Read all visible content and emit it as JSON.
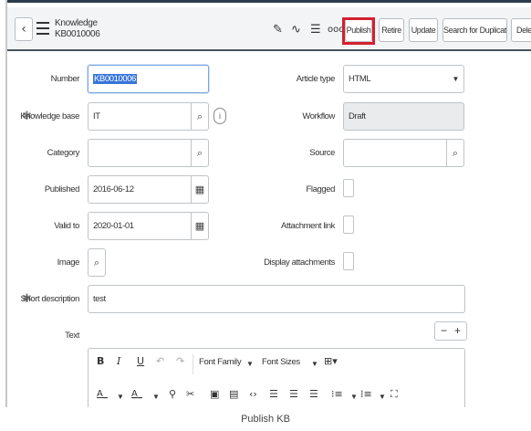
{
  "header": {
    "title": "Knowledge",
    "subtitle": "KB0010006",
    "buttons": {
      "publish": "Publish",
      "retire": "Retire",
      "update": "Update",
      "search_dup": "Search for Duplicates",
      "delete": "Delete"
    }
  },
  "form": {
    "number": {
      "label": "Number",
      "value": "KB0010006"
    },
    "knowledge_base": {
      "label": "Knowledge base",
      "value": "IT"
    },
    "category": {
      "label": "Category",
      "value": ""
    },
    "published": {
      "label": "Published",
      "value": "2016-06-12"
    },
    "valid_to": {
      "label": "Valid to",
      "value": "2020-01-01"
    },
    "image": {
      "label": "Image"
    },
    "short_description": {
      "label": "Short description",
      "value": "test"
    },
    "text": {
      "label": "Text"
    },
    "article_type": {
      "label": "Article type",
      "value": "HTML"
    },
    "workflow": {
      "label": "Workflow",
      "value": "Draft"
    },
    "source": {
      "label": "Source",
      "value": ""
    },
    "flagged": {
      "label": "Flagged",
      "checked": false
    },
    "attachment_link": {
      "label": "Attachment link",
      "checked": false
    },
    "display_attachments": {
      "label": "Display attachments",
      "checked": false
    }
  },
  "editor": {
    "font_family": "Font Family",
    "font_sizes": "Font Sizes"
  },
  "caption": "Publish KB",
  "colors": {
    "highlight": "#d22030",
    "header_border": "#48535e",
    "selection": "#3874d8"
  }
}
